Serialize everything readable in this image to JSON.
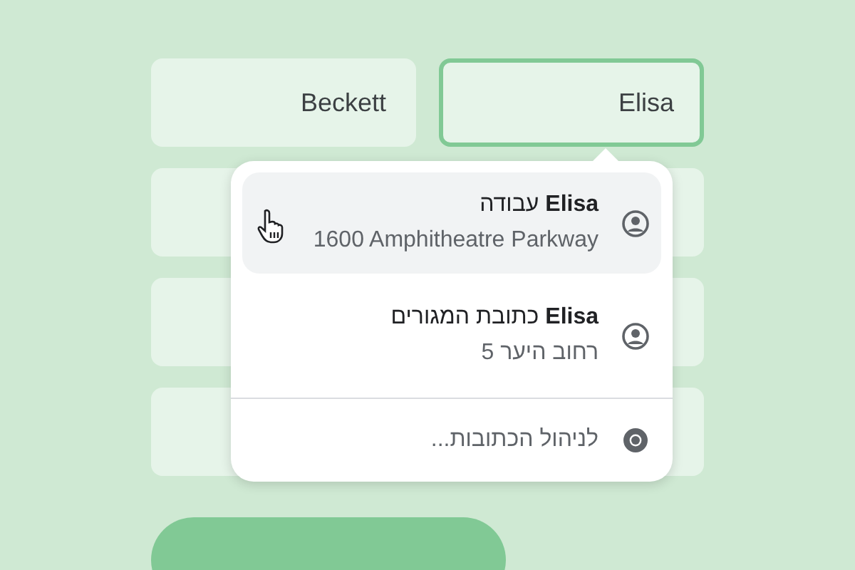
{
  "fields": [
    {
      "value": "Elisa",
      "focused": true
    },
    {
      "value": "Beckett",
      "focused": false
    },
    {
      "focused": false
    },
    {
      "focused": false
    },
    {
      "focused": false
    },
    {
      "focused": false
    },
    {
      "focused": false
    },
    {
      "focused": false
    }
  ],
  "dropdown": {
    "items": [
      {
        "title": "**Elisa** עבודה",
        "subtitle": "1600 Amphitheatre Parkway",
        "selected": true
      },
      {
        "title": "**Elisa** כתובת המגורים",
        "subtitle": "רחוב היער 5",
        "selected": false
      }
    ],
    "manage": {
      "label": "לניהול הכתובות..."
    }
  },
  "buttons": [
    {
      "kind": "primary"
    }
  ]
}
